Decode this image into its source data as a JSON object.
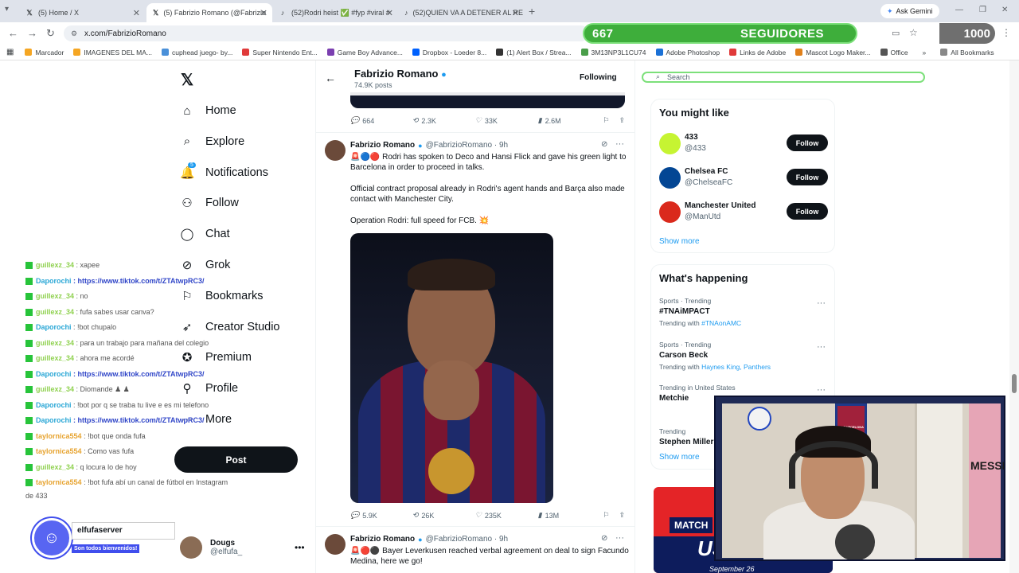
{
  "browser": {
    "tabs": [
      {
        "title": "(5) Home / X",
        "icon": "x-icon"
      },
      {
        "title": "(5) Fabrizio Romano (@Fabrizio",
        "icon": "x-icon"
      },
      {
        "title": "(52)Rodri heist ✅ #fyp #viral #",
        "icon": "tiktok-icon"
      },
      {
        "title": "(52)QUIEN VA A DETENER AL RE",
        "icon": "tiktok-icon"
      }
    ],
    "ask_gemini": "Ask Gemini",
    "url": "x.com/FabrizioRomano",
    "bookmarks": [
      {
        "label": "Marcador",
        "color": "#f5a623"
      },
      {
        "label": "IMAGENES DEL MA...",
        "color": "#f5a623"
      },
      {
        "label": "cuphead juego- by...",
        "color": "#4a90d9"
      },
      {
        "label": "Super Nintendo Ent...",
        "color": "#e03a3a"
      },
      {
        "label": "Game Boy Advance...",
        "color": "#7b3fb0"
      },
      {
        "label": "Dropbox - Loeder 8...",
        "color": "#0061fe"
      },
      {
        "label": "(1) Alert Box / Strea...",
        "color": "#333333"
      },
      {
        "label": "3M13NP3L1CU74",
        "color": "#4a9e4a"
      },
      {
        "label": "Adobe Photoshop",
        "color": "#1b71d6"
      },
      {
        "label": "Links de Adobe",
        "color": "#e03a3a"
      },
      {
        "label": "Mascot Logo Maker...",
        "color": "#e0801a"
      },
      {
        "label": "Office",
        "color": "#555555"
      }
    ],
    "all_bookmarks": "All Bookmarks"
  },
  "goal_overlay": {
    "current": "667",
    "label": "SEGUIDORES",
    "target": "1000",
    "progress_fraction": 0.667
  },
  "x_nav": {
    "items": [
      {
        "label": "Home",
        "icon": "home-icon"
      },
      {
        "label": "Explore",
        "icon": "search-icon"
      },
      {
        "label": "Notifications",
        "icon": "bell-icon",
        "badge": "5"
      },
      {
        "label": "Follow",
        "icon": "person-add-icon"
      },
      {
        "label": "Chat",
        "icon": "chat-icon"
      },
      {
        "label": "Grok",
        "icon": "grok-icon"
      },
      {
        "label": "Bookmarks",
        "icon": "bookmark-icon"
      },
      {
        "label": "Creator Studio",
        "icon": "rocket-icon"
      },
      {
        "label": "Premium",
        "icon": "verified-icon"
      },
      {
        "label": "Profile",
        "icon": "person-icon"
      },
      {
        "label": "More",
        "icon": "more-circle-icon"
      }
    ],
    "post_button": "Post",
    "user": {
      "name": "Dougs",
      "handle": "@elfufa_"
    }
  },
  "chat_overlay": [
    {
      "user": "guillexz_34",
      "color": "g",
      "msg": ": xapee",
      "link": false
    },
    {
      "user": "Daporochi",
      "color": "b",
      "msg": ": https://www.tiktok.com/t/ZTAtwpRC3/",
      "link": true
    },
    {
      "user": "guillexz_34",
      "color": "g",
      "msg": ": no",
      "link": false
    },
    {
      "user": "guillexz_34",
      "color": "g",
      "msg": ": fufa sabes usar canva?",
      "link": false
    },
    {
      "user": "Daporochi",
      "color": "b",
      "msg": ": !bot chupalo",
      "link": false
    },
    {
      "user": "guillexz_34",
      "color": "g",
      "msg": ": para un trabajo para mañana del colegio",
      "link": false
    },
    {
      "user": "guillexz_34",
      "color": "g",
      "msg": ": ahora me acordé",
      "link": false
    },
    {
      "user": "Daporochi",
      "color": "b",
      "msg": ": https://www.tiktok.com/t/ZTAtwpRC3/",
      "link": true
    },
    {
      "user": "guillexz_34",
      "color": "g",
      "msg": ": Diomande ♟ ♟",
      "link": false
    },
    {
      "user": "Daporochi",
      "color": "b",
      "msg": ": !bot por q se traba tu live e es mi telefono",
      "link": false
    },
    {
      "user": "Daporochi",
      "color": "b",
      "msg": ": https://www.tiktok.com/t/ZTAtwpRC3/",
      "link": true
    },
    {
      "user": "taylornica554",
      "color": "o",
      "msg": ": !bot que onda fufa",
      "link": false
    },
    {
      "user": "taylornica554",
      "color": "o",
      "msg": ": Como vas fufa",
      "link": false
    },
    {
      "user": "guillexz_34",
      "color": "g",
      "msg": ": q locura lo de hoy",
      "link": false
    },
    {
      "user": "taylornica554",
      "color": "o",
      "msg": ": !bot fufa abí un canal de fútbol en Instagram",
      "link": false
    }
  ],
  "chat_overlay_tail": "de 433",
  "discord": {
    "server": "elfufaserver",
    "welcome": "Son todos bienvenidos!"
  },
  "profile_header": {
    "name": "Fabrizio Romano",
    "posts": "74.9K posts",
    "following_button": "Following"
  },
  "top_post_actions": {
    "replies": "664",
    "reposts": "2.3K",
    "likes": "33K",
    "views": "2.6M"
  },
  "tweet1": {
    "name": "Fabrizio Romano",
    "meta": "@FabrizioRomano · 9h",
    "line1": "🚨🔵🔴 Rodri has spoken to Deco and Hansi Flick and gave his green light to Barcelona in order to proceed in talks.",
    "line2": "Official contract proposal already in Rodri's agent hands and Barça also made contact with Manchester City.",
    "line3": "Operation Rodri: full speed for FCB. 💥",
    "actions": {
      "replies": "5.9K",
      "reposts": "26K",
      "likes": "235K",
      "views": "13M"
    }
  },
  "tweet2": {
    "name": "Fabrizio Romano",
    "meta": "@FabrizioRomano · 9h",
    "line1": "🚨🔴⚫ Bayer Leverkusen reached verbal agreement on deal to sign Facundo Medina, here we go!"
  },
  "sidebar": {
    "search_placeholder": "Search",
    "you_might_like": "You might like",
    "suggestions": [
      {
        "name": "433",
        "handle": "@433",
        "color": "#c6f432",
        "button": "Follow"
      },
      {
        "name": "Chelsea FC",
        "handle": "@ChelseaFC",
        "color": "#034694",
        "button": "Follow"
      },
      {
        "name": "Manchester United",
        "handle": "@ManUtd",
        "color": "#da291c",
        "button": "Follow"
      }
    ],
    "show_more_1": "Show more",
    "whats_happening": "What's happening",
    "trends": [
      {
        "category": "Sports · Trending",
        "name": "#TNAiMPACT",
        "with_label": "Trending with",
        "with": "#TNAonAMC"
      },
      {
        "category": "Sports · Trending",
        "name": "Carson Beck",
        "with_label": "Trending with",
        "with": "Haynes King, Panthers"
      },
      {
        "category": "Trending in United States",
        "name": "Metchie",
        "with_label": "",
        "with": ""
      },
      {
        "category": "Trending",
        "name": "Stephen Miller",
        "with_label": "",
        "with": ""
      }
    ],
    "show_more_2": "Show more",
    "promo": {
      "tag": "MATCH",
      "big": "US",
      "date": "September 26"
    }
  },
  "webcam": {
    "flag_text": "FC BARCELONA",
    "poster_text": "MESSI"
  }
}
